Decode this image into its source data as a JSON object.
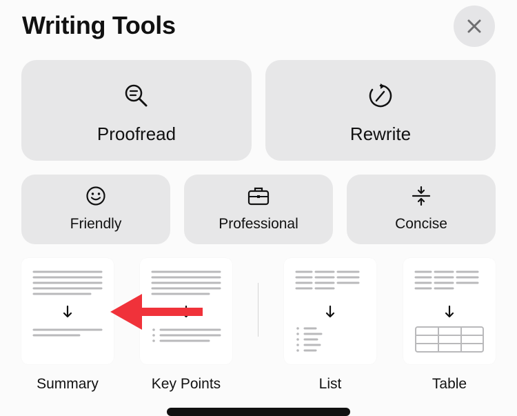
{
  "header": {
    "title": "Writing Tools"
  },
  "close": {
    "icon": "close-icon"
  },
  "primary_actions": [
    {
      "label": "Proofread",
      "icon": "magnify-text-icon"
    },
    {
      "label": "Rewrite",
      "icon": "rewrite-dial-icon"
    }
  ],
  "tone_actions": [
    {
      "label": "Friendly",
      "icon": "smiley-icon"
    },
    {
      "label": "Professional",
      "icon": "briefcase-icon"
    },
    {
      "label": "Concise",
      "icon": "compress-icon"
    }
  ],
  "format_actions": [
    {
      "label": "Summary",
      "icon": "summary-doc-icon"
    },
    {
      "label": "Key Points",
      "icon": "key-points-doc-icon"
    },
    {
      "label": "List",
      "icon": "list-doc-icon"
    },
    {
      "label": "Table",
      "icon": "table-doc-icon"
    }
  ],
  "colors": {
    "button_bg": "#e7e7e8",
    "card_bg": "#ffffff",
    "annotation_arrow": "#f0323a"
  }
}
